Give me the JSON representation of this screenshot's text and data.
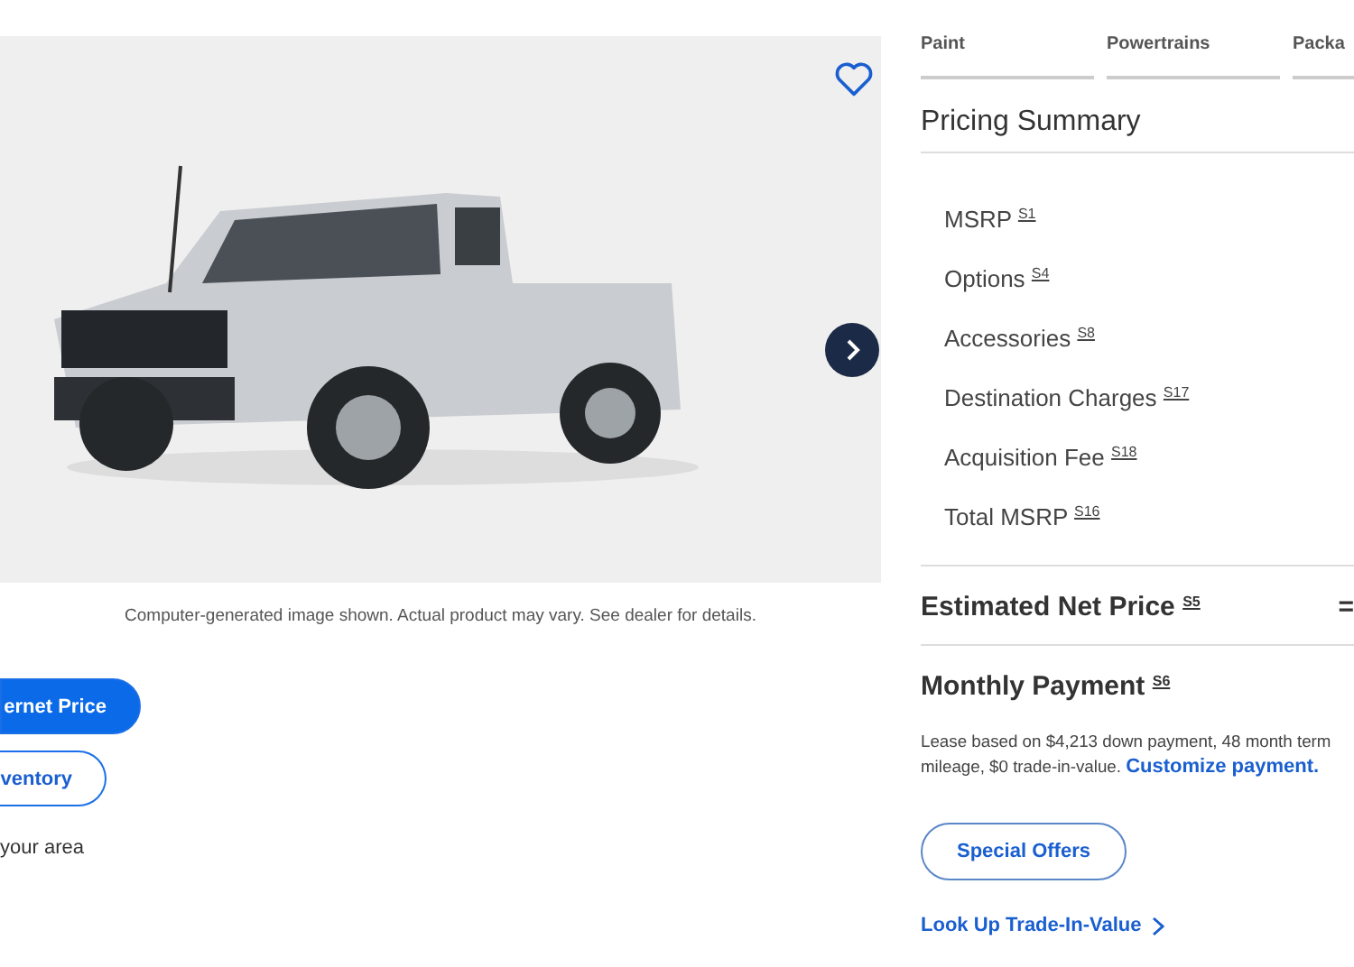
{
  "gallery": {
    "favorite": false,
    "caption": "Computer-generated image shown. Actual product may vary. See dealer for details."
  },
  "actions": [
    {
      "kind": "primary",
      "label": "ernet Price"
    },
    {
      "kind": "outline",
      "label": "ventory"
    }
  ],
  "area_note": "your area",
  "tabs": [
    {
      "label": "Paint",
      "selected": false
    },
    {
      "label": "Powertrains",
      "selected": false
    },
    {
      "label": "Packa",
      "selected": false
    }
  ],
  "pricing_summary": {
    "title": "Pricing Summary",
    "items": [
      "MSRP $^{S1}$",
      "Options $^{S4}$",
      "Accessories $^{S8}$",
      "Destination Charges $^{S17}$",
      "Acquisition Fee $^{S18}$",
      "Total MSRP $^{S16}$"
    ],
    "net_price": {
      "label": "Estimated Net Price $^{S5}$",
      "value": "="
    },
    "monthly": {
      "label": "Monthly Payment $^{S6}$",
      "note": "Lease based on $4,213 down payment, 48 month term",
      "note_2": "mileage, $0 trade-in-value.",
      "link": "Customize payment."
    },
    "special_offers": "Special Offers",
    "trade_in": "Look Up Trade-In-Value"
  }
}
